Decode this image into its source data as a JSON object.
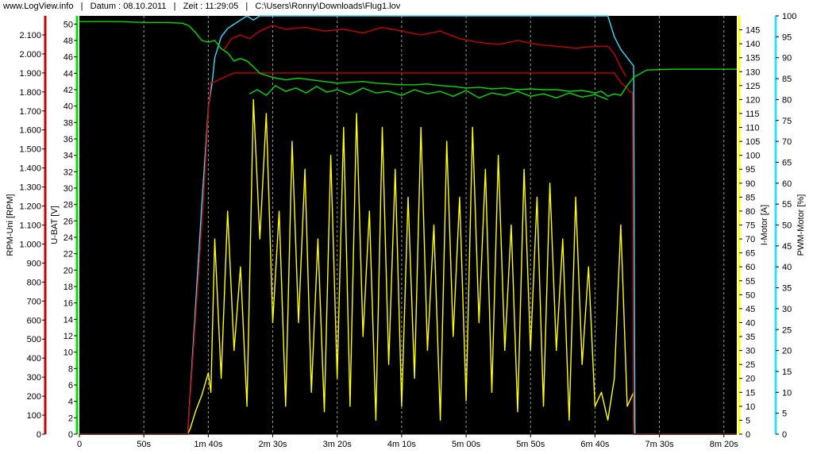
{
  "header": {
    "site": "www.LogView.info",
    "sep": "|",
    "date": "Datum : 08.10.2011",
    "time": "Zeit : 11:29:05",
    "file": "C:\\Users\\Ronny\\Downloads\\Flug1.lov"
  },
  "colors": {
    "background": "#000000",
    "rpm": "#cc0000",
    "ubat": "#00dd00",
    "imotor": "#ffff00",
    "pwm": "#33ddff",
    "grid": "#9a9a9a"
  },
  "chart_data": {
    "type": "line",
    "x_unit": "s",
    "xlim": [
      0,
      510
    ],
    "x_ticks": [
      {
        "v": 0,
        "label": "0"
      },
      {
        "v": 50,
        "label": "50s"
      },
      {
        "v": 100,
        "label": "1m 40s"
      },
      {
        "v": 150,
        "label": "2m 30s"
      },
      {
        "v": 200,
        "label": "3m 20s"
      },
      {
        "v": 250,
        "label": "4m 10s"
      },
      {
        "v": 300,
        "label": "5m 00s"
      },
      {
        "v": 350,
        "label": "5m 50s"
      },
      {
        "v": 400,
        "label": "6m 40s"
      },
      {
        "v": 450,
        "label": "7m 30s"
      },
      {
        "v": 500,
        "label": "8m 20s"
      }
    ],
    "axes": [
      {
        "id": "rpm",
        "label": "RPM-Uni [RPM]",
        "min": 0,
        "max": 2200,
        "ticks": [
          "0",
          "100",
          "200",
          "300",
          "400",
          "500",
          "600",
          "700",
          "800",
          "900",
          "1.000",
          "1.100",
          "1.200",
          "1.300",
          "1.400",
          "1.500",
          "1.600",
          "1.700",
          "1.800",
          "1.900",
          "2.000",
          "2.100"
        ],
        "tick_values": [
          0,
          100,
          200,
          300,
          400,
          500,
          600,
          700,
          800,
          900,
          1000,
          1100,
          1200,
          1300,
          1400,
          1500,
          1600,
          1700,
          1800,
          1900,
          2000,
          2100
        ]
      },
      {
        "id": "ubat",
        "label": "U-BAT [V]",
        "min": 0,
        "max": 51,
        "ticks": [
          "0",
          "2",
          "4",
          "6",
          "8",
          "10",
          "12",
          "14",
          "16",
          "18",
          "20",
          "22",
          "24",
          "26",
          "28",
          "30",
          "32",
          "34",
          "36",
          "38",
          "40",
          "42",
          "44",
          "46",
          "48",
          "50"
        ],
        "tick_values": [
          0,
          2,
          4,
          6,
          8,
          10,
          12,
          14,
          16,
          18,
          20,
          22,
          24,
          26,
          28,
          30,
          32,
          34,
          36,
          38,
          40,
          42,
          44,
          46,
          48,
          50
        ]
      },
      {
        "id": "imotor",
        "label": "I-Motor [A]",
        "min": 0,
        "max": 150,
        "ticks": [
          "0",
          "5",
          "10",
          "15",
          "20",
          "25",
          "30",
          "35",
          "40",
          "45",
          "50",
          "55",
          "60",
          "65",
          "70",
          "75",
          "80",
          "85",
          "90",
          "95",
          "100",
          "105",
          "110",
          "115",
          "120",
          "125",
          "130",
          "135",
          "140",
          "145"
        ],
        "tick_values": [
          0,
          5,
          10,
          15,
          20,
          25,
          30,
          35,
          40,
          45,
          50,
          55,
          60,
          65,
          70,
          75,
          80,
          85,
          90,
          95,
          100,
          105,
          110,
          115,
          120,
          125,
          130,
          135,
          140,
          145
        ]
      },
      {
        "id": "pwm",
        "label": "PWM-Motor [%]",
        "min": 0,
        "max": 100,
        "ticks": [
          "0",
          "5",
          "10",
          "15",
          "20",
          "25",
          "30",
          "35",
          "40",
          "45",
          "50",
          "55",
          "60",
          "65",
          "70",
          "75",
          "80",
          "85",
          "90",
          "95",
          "100"
        ],
        "tick_values": [
          0,
          5,
          10,
          15,
          20,
          25,
          30,
          35,
          40,
          45,
          50,
          55,
          60,
          65,
          70,
          75,
          80,
          85,
          90,
          95,
          100
        ]
      }
    ],
    "series": [
      {
        "name": "RPM-Uni [RPM]",
        "axis": "rpm",
        "color": "#cc0000",
        "x": [
          0,
          84,
          86,
          88,
          90,
          92,
          94,
          96,
          98,
          100,
          102,
          104,
          110,
          120,
          130,
          140,
          150,
          160,
          170,
          180,
          200,
          220,
          240,
          260,
          280,
          300,
          320,
          340,
          360,
          380,
          400,
          410,
          415,
          420,
          425,
          427,
          429,
          430,
          440,
          510
        ],
        "y": [
          0,
          0,
          200,
          400,
          600,
          800,
          1000,
          1200,
          1450,
          1700,
          1850,
          1850,
          1870,
          1900,
          1900,
          1900,
          1900,
          1900,
          1900,
          1900,
          1900,
          1900,
          1900,
          1900,
          1900,
          1900,
          1900,
          1900,
          1900,
          1900,
          1900,
          1900,
          1900,
          1850,
          1820,
          1800,
          1800,
          0,
          0,
          0
        ]
      },
      {
        "name": "RPM-Uni [RPM]",
        "axis": "rpm",
        "color": "#cc0000",
        "x": [
          112,
          118,
          125,
          132,
          140,
          150,
          160,
          175,
          190,
          205,
          220,
          235,
          250,
          265,
          280,
          295,
          310,
          325,
          340,
          355,
          370,
          385,
          400,
          410,
          415,
          420,
          424
        ],
        "y": [
          2020,
          2080,
          2100,
          2080,
          2120,
          2150,
          2130,
          2140,
          2120,
          2130,
          2110,
          2140,
          2120,
          2100,
          2120,
          2080,
          2060,
          2050,
          2070,
          2050,
          2040,
          2030,
          2040,
          2040,
          2000,
          1930,
          1880
        ]
      },
      {
        "name": "U-BAT [V]",
        "axis": "ubat",
        "color": "#00dd00",
        "x": [
          0,
          10,
          30,
          50,
          70,
          80,
          85,
          90,
          95,
          100,
          105,
          110,
          115,
          120,
          125,
          130,
          135,
          140,
          150,
          160,
          170,
          180,
          190,
          200,
          210,
          220,
          230,
          240,
          250,
          260,
          270,
          280,
          290,
          300,
          310,
          320,
          330,
          340,
          350,
          360,
          370,
          380,
          390,
          400,
          405,
          410,
          415,
          420,
          425,
          430,
          440,
          460,
          480,
          510
        ],
        "y": [
          50.3,
          50.3,
          50.3,
          50.2,
          50.2,
          50.1,
          49.8,
          49.0,
          48.0,
          47.8,
          48.0,
          47.0,
          46.5,
          45.5,
          45.8,
          45.5,
          44.8,
          44.0,
          43.5,
          43.2,
          43.4,
          43.2,
          43.0,
          42.8,
          42.9,
          43.0,
          42.8,
          42.7,
          42.6,
          42.6,
          42.7,
          42.5,
          42.4,
          42.2,
          42.3,
          42.1,
          42.2,
          42.0,
          42.1,
          42.0,
          42.0,
          41.8,
          41.9,
          41.6,
          41.8,
          41.2,
          41.5,
          41.3,
          42.5,
          43.5,
          44.4,
          44.5,
          44.5,
          44.5
        ]
      },
      {
        "name": "U-BAT [V]",
        "axis": "ubat",
        "color": "#00dd00",
        "x": [
          132,
          138,
          145,
          152,
          160,
          168,
          176,
          184,
          192,
          200,
          210,
          220,
          230,
          240,
          250,
          260,
          270,
          280,
          290,
          300,
          310,
          320,
          330,
          340,
          350,
          360,
          370,
          380,
          390,
          400,
          410
        ],
        "y": [
          41.5,
          42.0,
          41.3,
          42.5,
          41.8,
          42.2,
          41.6,
          42.4,
          41.7,
          42.0,
          41.4,
          42.2,
          41.6,
          41.8,
          41.3,
          42.0,
          41.5,
          41.8,
          41.2,
          41.9,
          41.0,
          41.6,
          41.3,
          41.8,
          41.2,
          41.5,
          41.0,
          41.6,
          41.1,
          41.4,
          40.8
        ]
      },
      {
        "name": "I-Motor [A]",
        "axis": "imotor",
        "color": "#ffff00",
        "x": [
          0,
          84,
          86,
          90,
          95,
          100,
          102,
          105,
          110,
          115,
          120,
          125,
          130,
          135,
          140,
          145,
          150,
          155,
          160,
          165,
          170,
          175,
          180,
          185,
          190,
          195,
          200,
          205,
          210,
          215,
          220,
          225,
          230,
          235,
          240,
          245,
          250,
          255,
          260,
          265,
          270,
          275,
          280,
          285,
          290,
          295,
          300,
          305,
          310,
          315,
          320,
          325,
          330,
          335,
          340,
          345,
          350,
          355,
          360,
          365,
          370,
          375,
          380,
          385,
          390,
          395,
          400,
          405,
          410,
          415,
          420,
          425,
          430,
          431,
          510
        ],
        "y": [
          0,
          0,
          2,
          8,
          14,
          22,
          15,
          70,
          20,
          80,
          30,
          60,
          10,
          120,
          70,
          115,
          40,
          80,
          10,
          105,
          40,
          95,
          15,
          70,
          8,
          100,
          20,
          110,
          10,
          115,
          35,
          80,
          5,
          110,
          25,
          95,
          10,
          85,
          20,
          110,
          30,
          75,
          5,
          105,
          35,
          85,
          12,
          110,
          40,
          95,
          15,
          100,
          30,
          75,
          8,
          95,
          30,
          85,
          10,
          90,
          30,
          70,
          5,
          85,
          25,
          60,
          10,
          15,
          5,
          20,
          75,
          10,
          15,
          0,
          0
        ]
      },
      {
        "name": "PWM-Motor [%]",
        "axis": "pwm",
        "color": "#33ddff",
        "x": [
          0,
          84,
          86,
          90,
          95,
          100,
          103,
          105,
          110,
          115,
          120,
          125,
          130,
          135,
          140,
          150,
          200,
          250,
          300,
          350,
          400,
          410,
          415,
          420,
          425,
          430,
          431,
          510
        ],
        "y": [
          0,
          0,
          10,
          30,
          55,
          78,
          84,
          90,
          95,
          97,
          98,
          99,
          100,
          99,
          100,
          100,
          100,
          100,
          100,
          100,
          100,
          100,
          95,
          92,
          90,
          88,
          0,
          0
        ]
      }
    ]
  }
}
